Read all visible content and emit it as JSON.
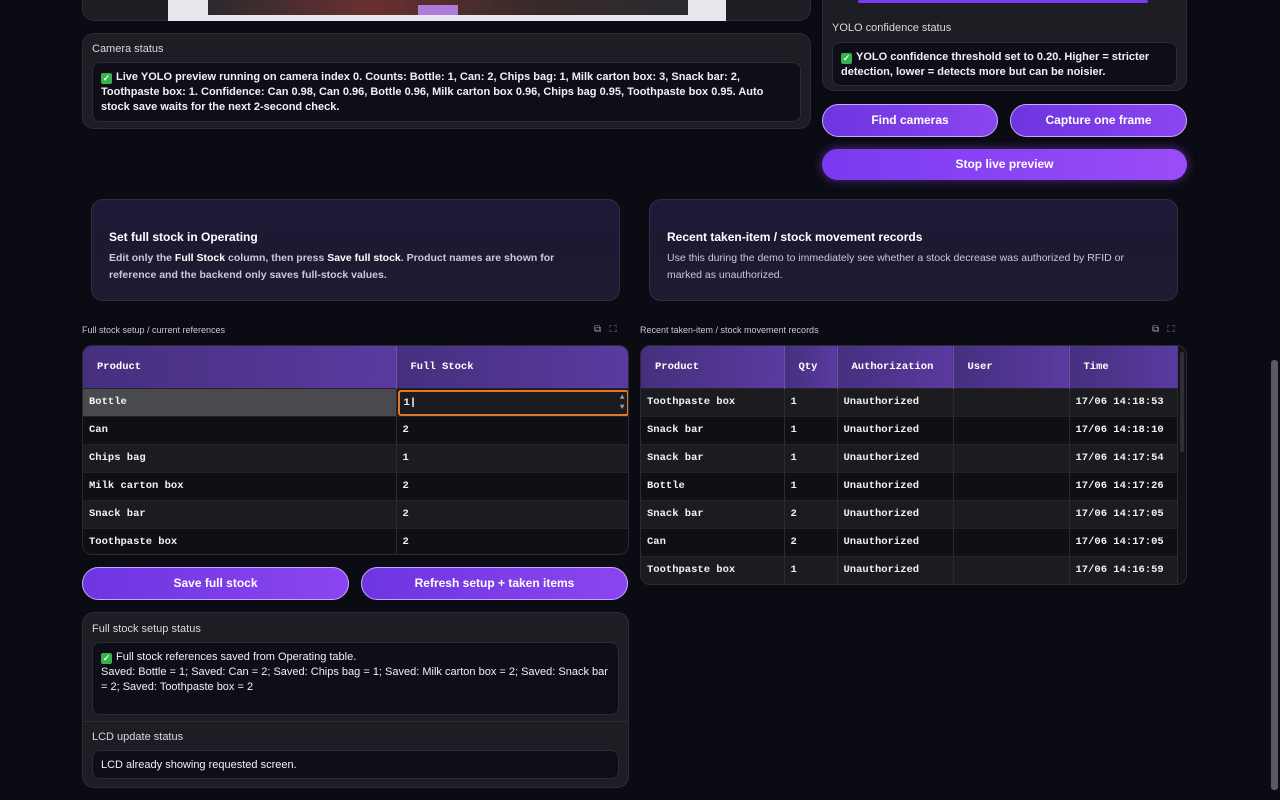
{
  "camera_status": {
    "label": "Camera status",
    "message": "Live YOLO preview running on camera index 0. Counts: Bottle: 1, Can: 2, Chips bag: 1, Milk carton box: 3, Snack bar: 2, Toothpaste box: 1. Confidence: Can 0.98, Can 0.96, Bottle 0.96, Milk carton box 0.96, Chips bag 0.95, Toothpaste box 0.95. Auto stock save waits for the next 2-second check."
  },
  "yolo_status": {
    "label": "YOLO confidence status",
    "message": "YOLO confidence threshold set to 0.20. Higher = stricter detection, lower = detects more but can be noisier."
  },
  "camera_buttons": {
    "find": "Find cameras",
    "capture": "Capture one frame",
    "stop": "Stop live preview"
  },
  "full_stock_info": {
    "title": "Set full stock in Operating",
    "desc_pre": "Edit only the ",
    "desc_b1": "Full Stock",
    "desc_mid": " column, then press ",
    "desc_b2": "Save full stock",
    "desc_post": ". Product names are shown for reference and the backend only saves full-stock values."
  },
  "records_info": {
    "title": "Recent taken-item / stock movement records",
    "desc": "Use this during the demo to immediately see whether a stock decrease was authorized by RFID or marked as unauthorized."
  },
  "full_stock_table": {
    "label": "Full stock setup / current references",
    "columns": [
      "Product",
      "Full Stock"
    ],
    "rows": [
      {
        "product": "Bottle",
        "stock": "1"
      },
      {
        "product": "Can",
        "stock": "2"
      },
      {
        "product": "Chips bag",
        "stock": "1"
      },
      {
        "product": "Milk carton box",
        "stock": "2"
      },
      {
        "product": "Snack bar",
        "stock": "2"
      },
      {
        "product": "Toothpaste box",
        "stock": "2"
      }
    ]
  },
  "records_table": {
    "label": "Recent taken-item / stock movement records",
    "columns": [
      "Product",
      "Qty",
      "Authorization",
      "User",
      "Time"
    ],
    "rows": [
      {
        "product": "Toothpaste box",
        "qty": "1",
        "auth": "Unauthorized",
        "user": "",
        "time": "17/06 14:18:53"
      },
      {
        "product": "Snack bar",
        "qty": "1",
        "auth": "Unauthorized",
        "user": "",
        "time": "17/06 14:18:10"
      },
      {
        "product": "Snack bar",
        "qty": "1",
        "auth": "Unauthorized",
        "user": "",
        "time": "17/06 14:17:54"
      },
      {
        "product": "Bottle",
        "qty": "1",
        "auth": "Unauthorized",
        "user": "",
        "time": "17/06 14:17:26"
      },
      {
        "product": "Snack bar",
        "qty": "2",
        "auth": "Unauthorized",
        "user": "",
        "time": "17/06 14:17:05"
      },
      {
        "product": "Can",
        "qty": "2",
        "auth": "Unauthorized",
        "user": "",
        "time": "17/06 14:17:05"
      },
      {
        "product": "Toothpaste box",
        "qty": "1",
        "auth": "Unauthorized",
        "user": "",
        "time": "17/06 14:16:59"
      }
    ]
  },
  "stock_buttons": {
    "save": "Save full stock",
    "refresh": "Refresh setup + taken items"
  },
  "full_stock_status": {
    "label": "Full stock setup status",
    "line1": "Full stock references saved from Operating table.",
    "line2": "Saved: Bottle = 1; Saved: Can = 2; Saved: Chips bag = 1; Saved: Milk carton box = 2; Saved: Snack bar = 2; Saved: Toothpaste box = 2"
  },
  "lcd_status": {
    "label": "LCD update status",
    "message": "LCD already showing requested screen."
  },
  "colors": {
    "accent": "#7a3af0",
    "edit_border": "#e0782c",
    "check": "#37b24d"
  }
}
